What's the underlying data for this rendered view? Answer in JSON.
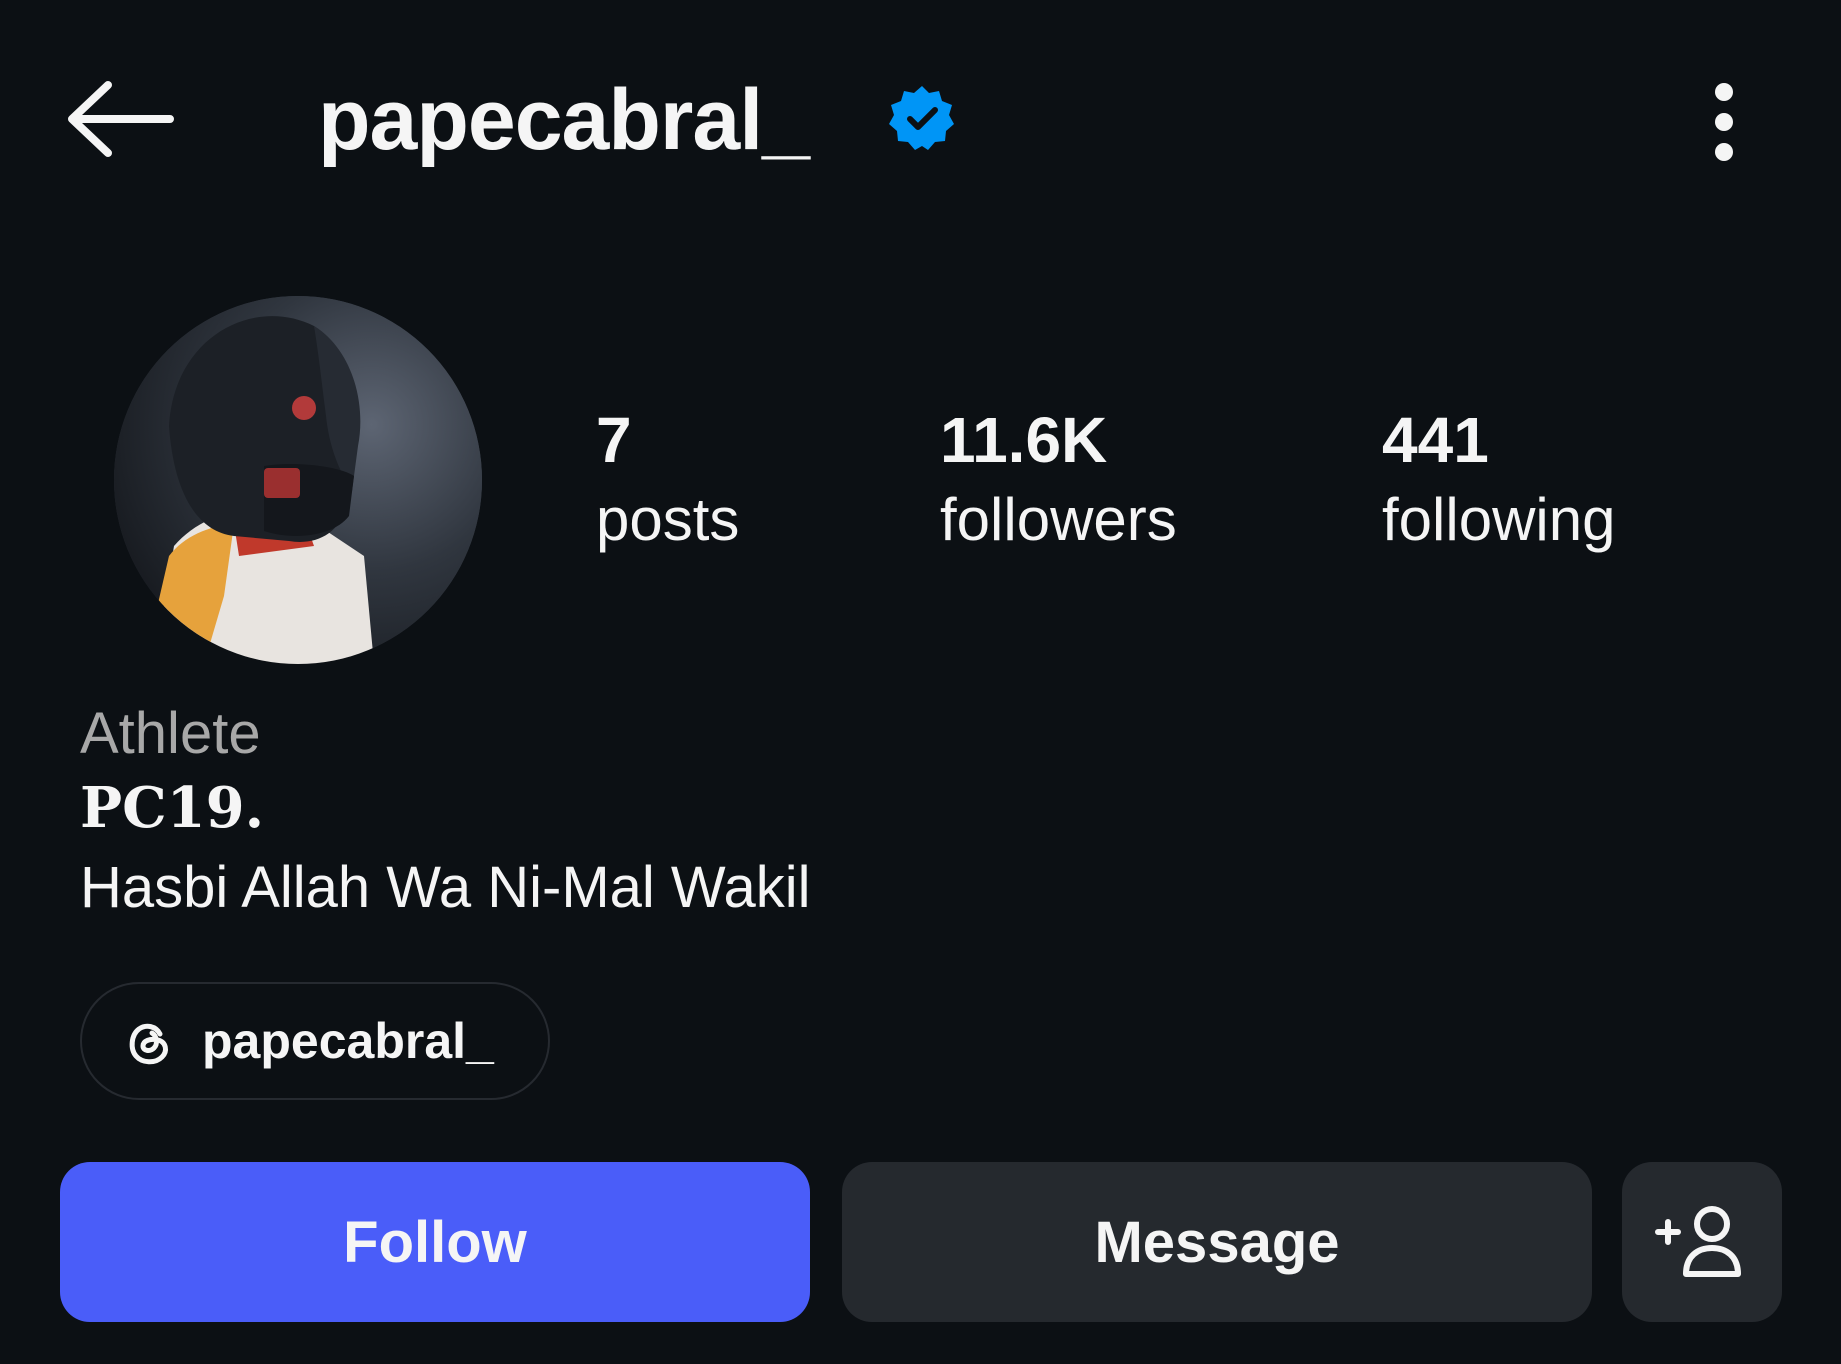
{
  "header": {
    "back_icon": "arrow-left-icon",
    "username": "papecabral_",
    "verified_icon": "verified-badge-icon",
    "verified_color": "#0095f6",
    "more_icon": "more-vertical-icon"
  },
  "profile": {
    "avatar_alt": "profile-photo",
    "stats": [
      {
        "value": "7",
        "label": "posts"
      },
      {
        "value": "11.6K",
        "label": "followers"
      },
      {
        "value": "441",
        "label": "following"
      }
    ],
    "category": "Athlete",
    "bio_title": "PC19.",
    "bio_line": "Hasbi Allah Wa Ni-Mal Wakil",
    "threads": {
      "icon": "threads-icon",
      "handle": "papecabral_"
    }
  },
  "actions": {
    "follow_label": "Follow",
    "follow_color": "#4a5df9",
    "message_label": "Message",
    "add_user_icon": "add-user-icon"
  }
}
